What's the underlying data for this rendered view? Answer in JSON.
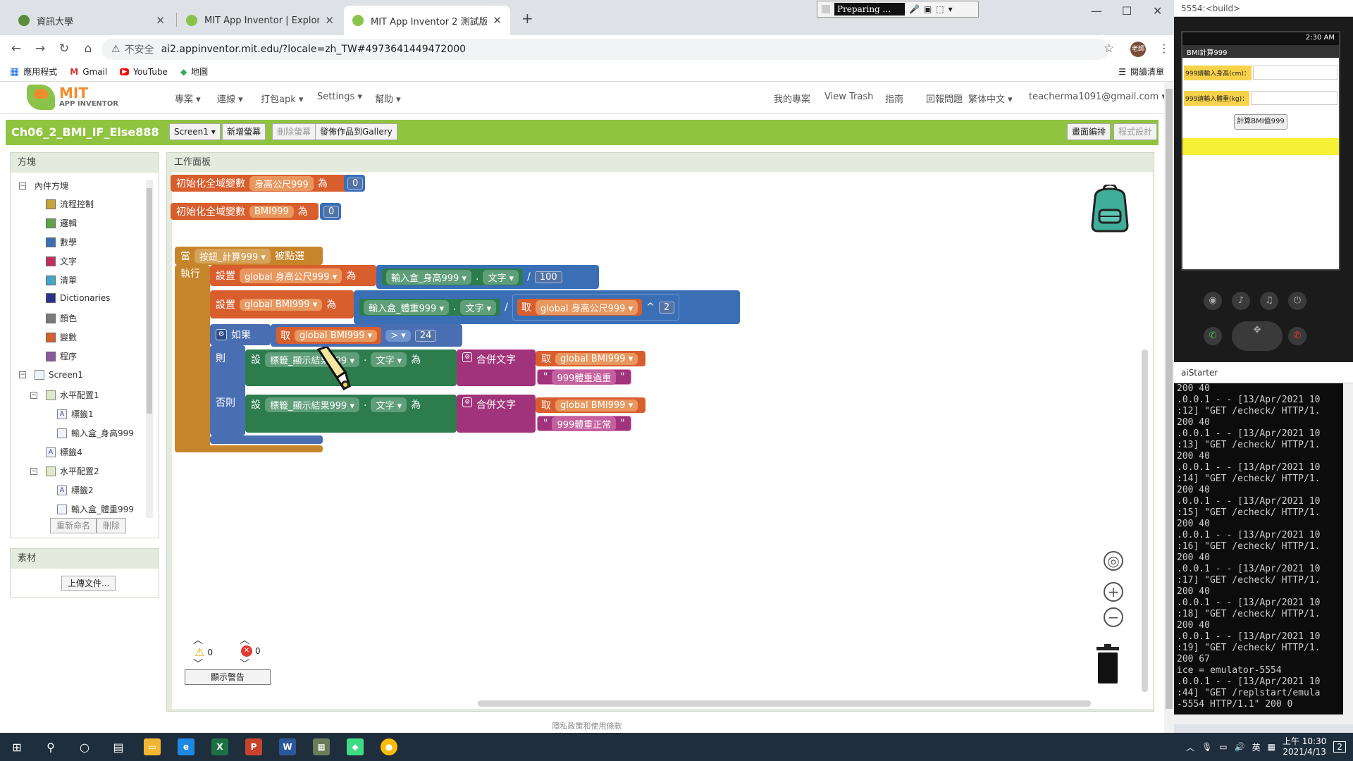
{
  "browser": {
    "tabs": [
      {
        "title": "資訊大學",
        "favicon_color": "#5b8c3a"
      },
      {
        "title": "MIT App Inventor | Explore MIT",
        "favicon_color": "#8bc34a"
      },
      {
        "title": "MIT App Inventor 2 測試版",
        "favicon_color": "#8bc34a"
      }
    ],
    "recorder_status": "Preparing ...",
    "security_label": "不安全",
    "url": "ai2.appinventor.mit.edu/?locale=zh_TW#4973641449472000",
    "bookmarks": [
      "應用程式",
      "Gmail",
      "YouTube",
      "地圖"
    ],
    "reading_list": "閱讀清單",
    "avatar_text": "老師"
  },
  "appinventor": {
    "logo_main": "MIT",
    "logo_sub": "APP INVENTOR",
    "menu": [
      "專案",
      "連線",
      "打包apk",
      "Settings",
      "幫助"
    ],
    "right_menu": [
      "我的專案",
      "View Trash",
      "指南",
      "回報問題",
      "繁体中文"
    ],
    "user_email": "teacherma1091@gmail.com",
    "project_name": "Ch06_2_BMI_IF_Else888",
    "screen_select": "Screen1",
    "add_screen": "新增螢幕",
    "remove_screen": "刪除螢幕",
    "publish_gallery": "發佈作品到Gallery",
    "designer_btn": "畫面編排",
    "blocks_btn": "程式設計",
    "blocks_panel_title": "方塊",
    "builtin_label": "內件方塊",
    "builtin": [
      {
        "label": "流程控制",
        "color": "#c7a53a"
      },
      {
        "label": "邏輯",
        "color": "#5ea34a"
      },
      {
        "label": "數學",
        "color": "#3a6fb6"
      },
      {
        "label": "文字",
        "color": "#c1305a"
      },
      {
        "label": "清單",
        "color": "#41a9c7"
      },
      {
        "label": "Dictionaries",
        "color": "#2c2f8c"
      },
      {
        "label": "顏色",
        "color": "#7a7a7a"
      },
      {
        "label": "變數",
        "color": "#d85e2e"
      },
      {
        "label": "程序",
        "color": "#8a5aa0"
      }
    ],
    "components": {
      "screen": "Screen1",
      "items": [
        "水平配置1",
        "標籤1",
        "輸入盒_身高999",
        "標籤4",
        "水平配置2",
        "標籤2",
        "輸入盒_體重999"
      ]
    },
    "rename_btn": "重新命名",
    "delete_btn": "刪除",
    "media_title": "素材",
    "upload_btn": "上傳文件...",
    "workspace_title": "工作面板",
    "blocks": {
      "init1": {
        "label": "初始化全域變數",
        "var": "身高公尺999",
        "as": "為",
        "value": "0"
      },
      "init2": {
        "label": "初始化全域變數",
        "var": "BMI999",
        "as": "為",
        "value": "0"
      },
      "when": "當",
      "button": "按鈕_計算999",
      "clicked": "被點選",
      "do": "執行",
      "set": "設置",
      "set_var1": "global 身高公尺999",
      "to": "為",
      "textbox1": "輸入盒_身高999",
      "text_prop": "文字",
      "div": "/",
      "hundred": "100",
      "set_var2": "global BMI999",
      "textbox2": "輸入盒_體重999",
      "get": "取",
      "get_height": "global 身高公尺999",
      "pow": "^",
      "two": "2",
      "if": "如果",
      "get_bmi": "global BMI999",
      "gt": ">",
      "threshold": "24",
      "then": "則",
      "set_short": "設",
      "label_result": "標籤_顯示結果999",
      "join": "合併文字",
      "msg_over": "999體重過重",
      "else": "否則",
      "msg_normal": "999體重正常"
    },
    "warnings": {
      "warn_count": "0",
      "error_count": "0",
      "show_warnings": "顯示警告"
    },
    "footer": "隱私政策和使用條款"
  },
  "emulator": {
    "title": "5554:<build>",
    "time": "2:30 AM",
    "app_title": "BMI計算999",
    "label_height": "999請輸入身高(cm)：",
    "label_weight": "999請輸入體重(kg)：",
    "calc_button": "計算BMI值999"
  },
  "aistarter": {
    "title": "aiStarter",
    "log": "200 40\n.0.0.1 - - [13/Apr/2021 10\n:12] \"GET /echeck/ HTTP/1.\n200 40\n.0.0.1 - - [13/Apr/2021 10\n:13] \"GET /echeck/ HTTP/1.\n200 40\n.0.0.1 - - [13/Apr/2021 10\n:14] \"GET /echeck/ HTTP/1.\n200 40\n.0.0.1 - - [13/Apr/2021 10\n:15] \"GET /echeck/ HTTP/1.\n200 40\n.0.0.1 - - [13/Apr/2021 10\n:16] \"GET /echeck/ HTTP/1.\n200 40\n.0.0.1 - - [13/Apr/2021 10\n:17] \"GET /echeck/ HTTP/1.\n200 40\n.0.0.1 - - [13/Apr/2021 10\n:18] \"GET /echeck/ HTTP/1.\n200 40\n.0.0.1 - - [13/Apr/2021 10\n:19] \"GET /echeck/ HTTP/1.\n200 67\nice = emulator-5554\n.0.0.1 - - [13/Apr/2021 10\n:44] \"GET /replstart/emula\n-5554 HTTP/1.1\" 200 0"
  },
  "taskbar": {
    "time": "上午 10:30",
    "date": "2021/4/13",
    "ime": "英",
    "notifications": "2"
  }
}
